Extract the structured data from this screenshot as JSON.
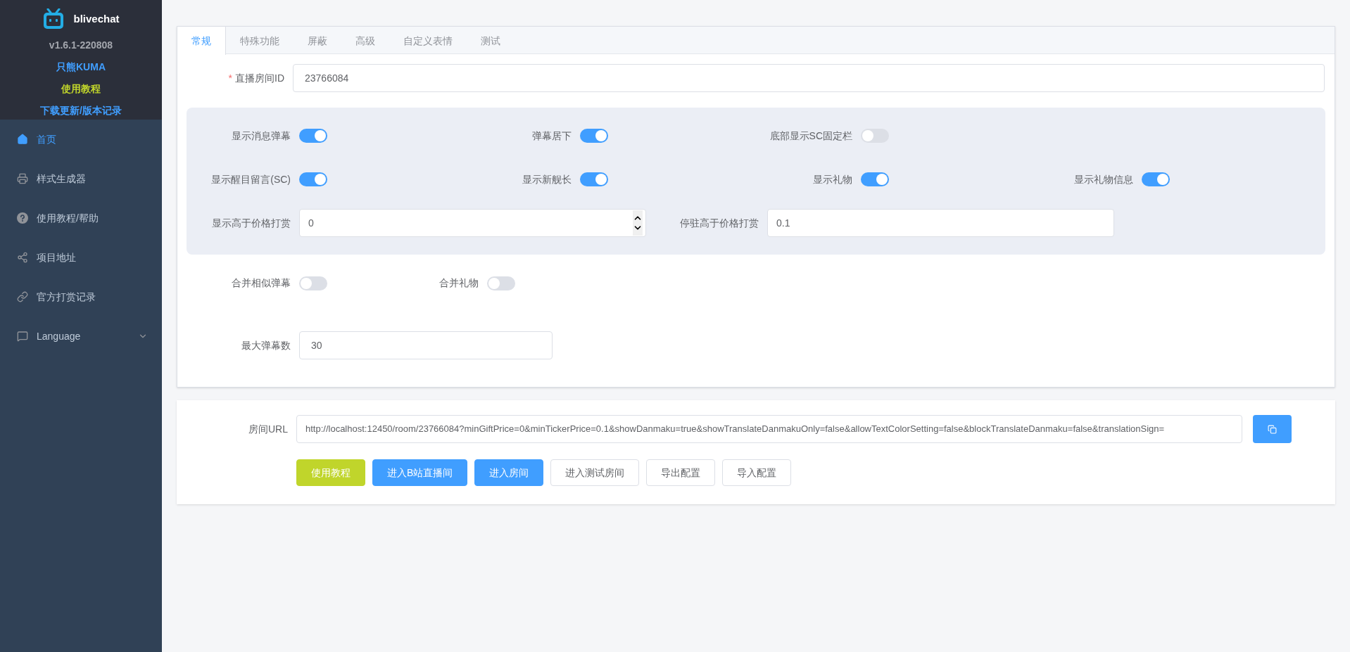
{
  "sidebar": {
    "brand": "blivechat",
    "version": "v1.6.1-220808",
    "links": [
      {
        "label": "只熊KUMA",
        "color": "#409eff"
      },
      {
        "label": "使用教程",
        "color": "#c0d52b"
      },
      {
        "label": "下载更新/版本记录",
        "color": "#409eff"
      }
    ],
    "menu": [
      {
        "kind": "home",
        "label": "首页",
        "selected": true
      },
      {
        "kind": "generator",
        "label": "样式生成器",
        "selected": false
      },
      {
        "kind": "help",
        "label": "使用教程/帮助",
        "selected": false
      },
      {
        "kind": "share",
        "label": "项目地址",
        "selected": false
      },
      {
        "kind": "link",
        "label": "官方打赏记录",
        "selected": false
      },
      {
        "kind": "language",
        "label": "Language",
        "selected": false
      }
    ]
  },
  "tabs": [
    {
      "label": "常规",
      "selected": true
    },
    {
      "label": "特殊功能",
      "selected": false
    },
    {
      "label": "屏蔽",
      "selected": false
    },
    {
      "label": "高级",
      "selected": false
    },
    {
      "label": "自定义表情",
      "selected": false
    },
    {
      "label": "测试",
      "selected": false
    }
  ],
  "room_id": {
    "label": "直播房间ID",
    "required_mark": "*",
    "value": "23766084"
  },
  "options_panel": [
    [
      {
        "kind": "switch",
        "label": "显示消息弹幕",
        "on": true
      },
      {
        "kind": "switch",
        "label": "弹幕居下",
        "on": true
      },
      {
        "kind": "switch",
        "label": "底部显示SC固定栏",
        "on": false
      }
    ],
    [
      {
        "kind": "switch",
        "label": "显示醒目留言(SC)",
        "on": true
      },
      {
        "kind": "switch",
        "label": "显示新舰长",
        "on": true
      },
      {
        "kind": "switch",
        "label": "显示礼物",
        "on": true
      },
      {
        "kind": "switch",
        "label": "显示礼物信息",
        "on": true
      }
    ],
    [
      {
        "kind": "number",
        "label": "显示高于价格打赏",
        "value": "0"
      },
      {
        "kind": "text",
        "label": "停驻高于价格打赏",
        "value": "0.1"
      }
    ]
  ],
  "merge_options": [
    {
      "label": "合并相似弹幕",
      "on": false
    },
    {
      "label": "合并礼物",
      "on": false
    }
  ],
  "max_danmaku": {
    "label": "最大弹幕数",
    "value": "30"
  },
  "url_card": {
    "label": "房间URL",
    "value": "http://localhost:12450/room/23766084?minGiftPrice=0&minTickerPrice=0.1&showDanmaku=true&showTranslateDanmakuOnly=false&allowTextColorSetting=false&blockTranslateDanmaku=false&translationSign=",
    "buttons": [
      {
        "label": "使用教程",
        "kind": "success"
      },
      {
        "label": "进入B站直播间",
        "kind": "primary"
      },
      {
        "label": "进入房间",
        "kind": "primary"
      },
      {
        "label": "进入测试房间",
        "kind": "default"
      },
      {
        "label": "导出配置",
        "kind": "default"
      },
      {
        "label": "导入配置",
        "kind": "default"
      }
    ]
  }
}
